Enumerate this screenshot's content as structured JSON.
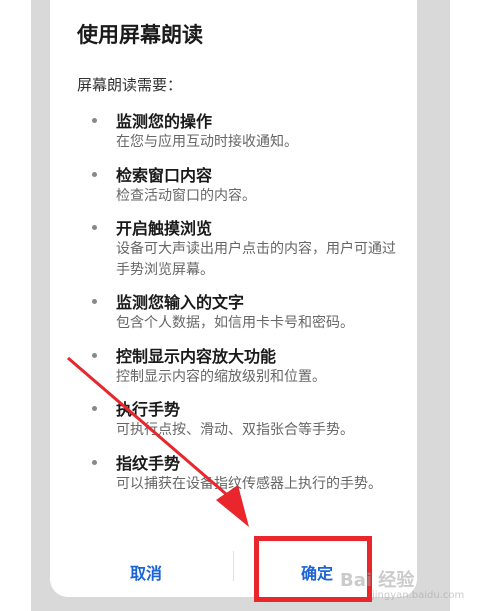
{
  "dialog": {
    "title": "使用屏幕朗读",
    "intro": "屏幕朗读需要：",
    "permissions": [
      {
        "title": "监测您的操作",
        "desc": "在您与应用互动时接收通知。"
      },
      {
        "title": "检索窗口内容",
        "desc": "检查活动窗口的内容。"
      },
      {
        "title": "开启触摸浏览",
        "desc": "设备可大声读出用户点击的内容，用户可通过手势浏览屏幕。"
      },
      {
        "title": "监测您输入的文字",
        "desc": "包含个人数据，如信用卡卡号和密码。"
      },
      {
        "title": "控制显示内容放大功能",
        "desc": "控制显示内容的缩放级别和位置。"
      },
      {
        "title": "执行手势",
        "desc": "可执行点按、滑动、双指张合等手势。"
      },
      {
        "title": "指纹手势",
        "desc": "可以捕获在设备指纹传感器上执行的手势。"
      }
    ],
    "cancel_label": "取消",
    "confirm_label": "确定"
  },
  "annotation": {
    "highlight_color": "#e8262b"
  },
  "watermark": {
    "text": "Bai 经验",
    "sub": "jingyan.baidu.com"
  },
  "colors": {
    "accent": "#1b64d8",
    "backdrop": "#d9d9d9"
  }
}
